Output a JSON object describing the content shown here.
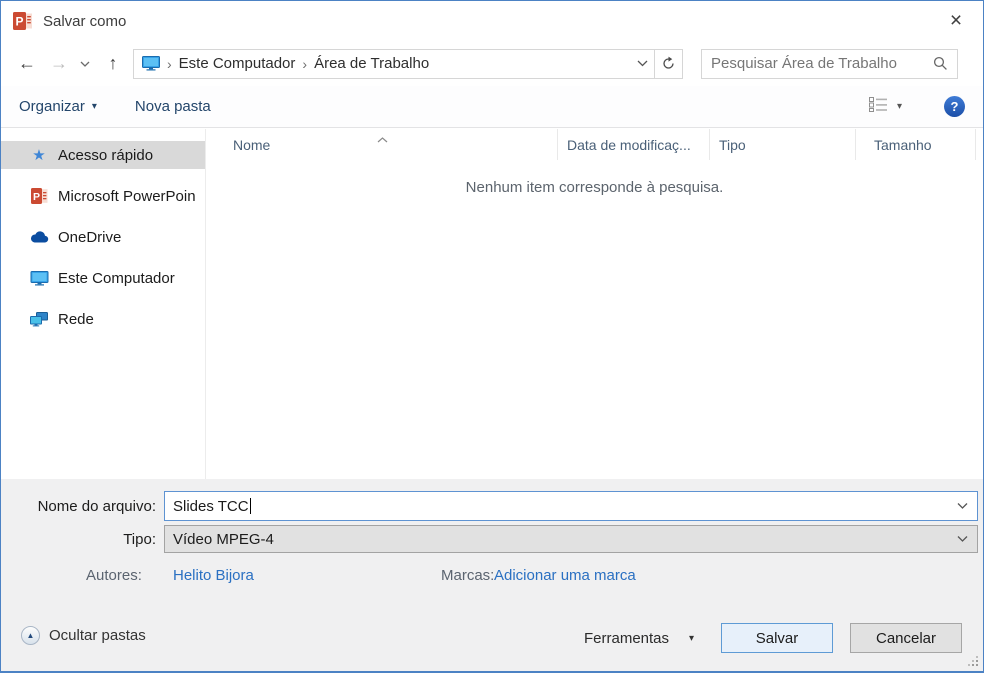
{
  "window": {
    "title": "Salvar como"
  },
  "nav": {
    "breadcrumb_items": [
      "Este Computador",
      "Área de Trabalho"
    ],
    "separator": "›",
    "search_placeholder": "Pesquisar Área de Trabalho"
  },
  "toolbar": {
    "organize": "Organizar",
    "new_folder": "Nova pasta"
  },
  "sidebar": {
    "items": [
      {
        "label": "Acesso rápido",
        "icon": "star-icon",
        "selected": true
      },
      {
        "label": "Microsoft PowerPoin",
        "icon": "powerpoint-icon",
        "selected": false
      },
      {
        "label": "OneDrive",
        "icon": "onedrive-cloud-icon",
        "selected": false
      },
      {
        "label": "Este Computador",
        "icon": "computer-icon",
        "selected": false
      },
      {
        "label": "Rede",
        "icon": "network-icon",
        "selected": false
      }
    ]
  },
  "file_list": {
    "columns": [
      "Nome",
      "Data de modificaç...",
      "Tipo",
      "Tamanho"
    ],
    "empty_message": "Nenhum item corresponde à pesquisa."
  },
  "fields": {
    "filename_label": "Nome do arquivo:",
    "filename_value": "Slides TCC",
    "type_label": "Tipo:",
    "type_value": "Vídeo MPEG-4",
    "authors_label": "Autores:",
    "authors_value": "Helito Bijora",
    "tags_label": "Marcas:",
    "tags_link": "Adicionar uma marca"
  },
  "footer": {
    "hide_folders": "Ocultar pastas",
    "tools": "Ferramentas",
    "save": "Salvar",
    "cancel": "Cancelar"
  },
  "icons": {
    "back": "←",
    "forward": "→",
    "up": "↑",
    "caret_down": "▾",
    "triangle_up": "▲",
    "close": "×",
    "help": "?",
    "star": "★"
  },
  "colors": {
    "accent_border": "#4c82c4",
    "link_blue": "#2a70c2",
    "selected_bg": "#d9d9d9",
    "save_button_border": "#5e9bd5"
  }
}
